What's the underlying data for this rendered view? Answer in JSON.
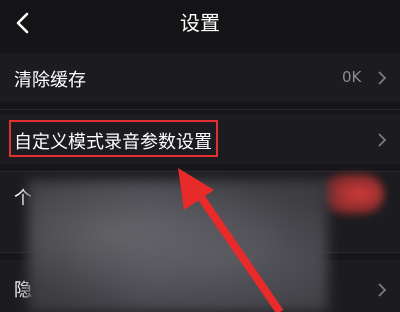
{
  "header": {
    "title": "设置"
  },
  "rows": [
    {
      "label": "清除缓存",
      "value": "0K"
    },
    {
      "label": "自定义模式录音参数设置"
    },
    {
      "label": "个"
    },
    {
      "label": "隐"
    }
  ],
  "colors": {
    "highlight": "#e23030",
    "background": "#16161a"
  }
}
